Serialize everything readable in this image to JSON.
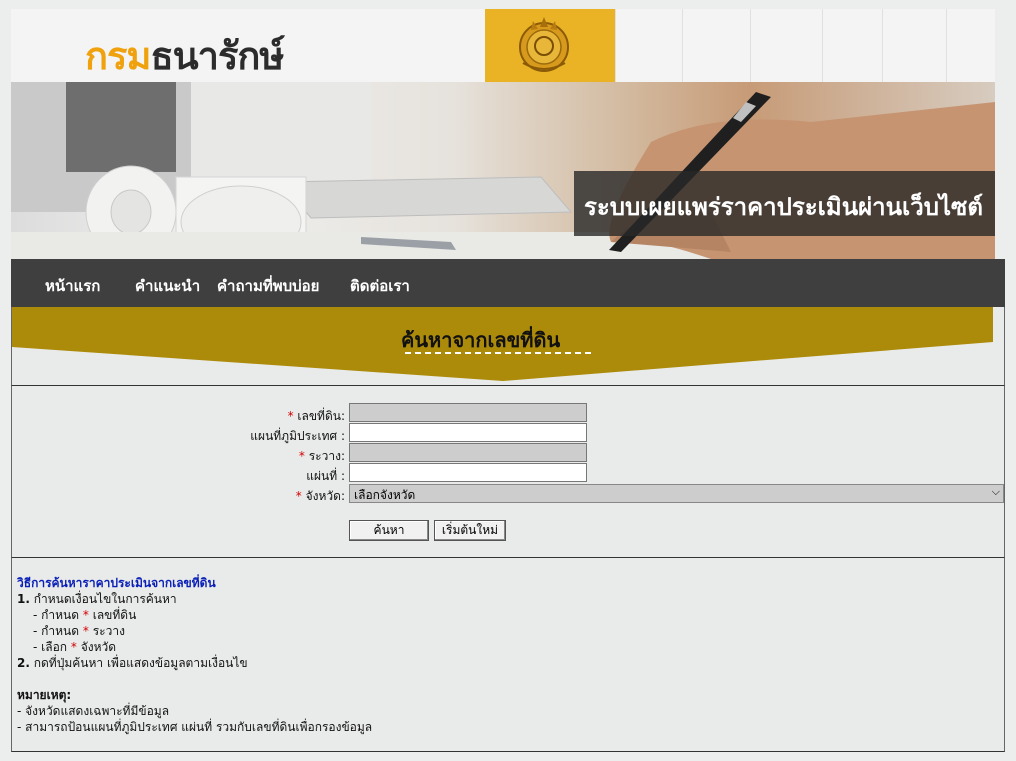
{
  "header": {
    "logo_part1": "กรม",
    "logo_part2": "ธนารักษ์",
    "banner_title": "ระบบเผยแพร่ราคาประเมินผ่านเว็บไซต์"
  },
  "nav": {
    "items": [
      {
        "label": "หน้าแรก"
      },
      {
        "label": "คำแนะนำ"
      },
      {
        "label": "คำถามที่พบบ่อย"
      },
      {
        "label": "ติดต่อเรา"
      }
    ]
  },
  "search": {
    "title": "ค้นหาจากเลขที่ดิน",
    "required_mark": "*",
    "fields": {
      "land_no_label": "เลขที่ดิน:",
      "map_label": "แผนที่ภูมิประเทศ :",
      "rawang_label": "ระวาง:",
      "sheet_label": "แผ่นที่ :",
      "province_label": "จังหวัด:"
    },
    "province_selected": "เลือกจังหวัด",
    "search_button": "ค้นหา",
    "reset_button": "เริ่มต้นใหม่"
  },
  "instructions": {
    "heading": "วิธีการค้นหาราคาประเมินจากเลขที่ดิน",
    "step1_num": "1.",
    "step1": "กำหนดเงื่อนไขในการค้นหา",
    "sub1_pre": "- กำหนด",
    "sub1_post": "เลขที่ดิน",
    "sub2_pre": "- กำหนด",
    "sub2_post": "ระวาง",
    "sub3_pre": "- เลือก",
    "sub3_post": "จังหวัด",
    "step2_num": "2.",
    "step2": "กดที่ปุ่มค้นหา เพื่อแสดงข้อมูลตามเงื่อนไข",
    "note_heading": "หมายเหตุ:",
    "note1": "- จังหวัดแสดงเฉพาะที่มีข้อมูล",
    "note2": "- สามารถป้อนแผนที่ภูมิประเทศ แผ่นที่ รวมกับเลขที่ดินเพื่อกรองข้อมูล"
  },
  "colors": {
    "accent": "#f0a10e",
    "gold_band": "#ac8a0a",
    "nav_bg": "#3f3f3f",
    "link_blue": "#0a1fb8",
    "required": "#d20000"
  }
}
